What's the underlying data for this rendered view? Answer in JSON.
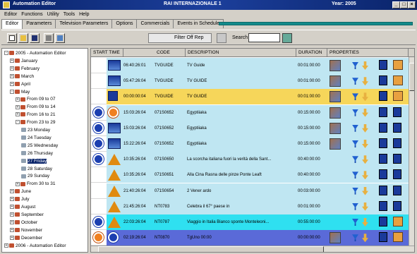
{
  "window": {
    "title": "Automation Editor",
    "channel": "RAI INTERNAZIONALE 1",
    "year": "Year: 2005",
    "controls": [
      "_",
      "□",
      "×"
    ]
  },
  "menu": [
    "Editor",
    "Functions",
    "Utility",
    "Tools",
    "Help"
  ],
  "tabs": [
    "Editor",
    "Parameters",
    "Television Parameters",
    "Options",
    "Commercials",
    "Events in Schedule"
  ],
  "toolbar": {
    "buttons": [
      "new-icon",
      "open-icon",
      "save-icon",
      "print-icon",
      "layout-icon"
    ],
    "filter_label": "Filter Off Rep",
    "search_label": "Search",
    "search_value": ""
  },
  "tree": [
    {
      "label": "2005 - Automation Editor",
      "level": 0,
      "toggle": "-"
    },
    {
      "label": "January",
      "level": 1,
      "toggle": "+"
    },
    {
      "label": "February",
      "level": 1,
      "toggle": "+"
    },
    {
      "label": "March",
      "level": 1,
      "toggle": "+"
    },
    {
      "label": "April",
      "level": 1,
      "toggle": "+"
    },
    {
      "label": "May",
      "level": 1,
      "toggle": "-"
    },
    {
      "label": "From 09 to 07",
      "level": 2,
      "toggle": "+"
    },
    {
      "label": "From 09 to 14",
      "level": 2,
      "toggle": "+"
    },
    {
      "label": "From 16 to 21",
      "level": 2,
      "toggle": "+"
    },
    {
      "label": "From 23 to 29",
      "level": 2,
      "toggle": "-"
    },
    {
      "label": "23 Monday",
      "level": 3,
      "toggle": ""
    },
    {
      "label": "24 Tuesday",
      "level": 3,
      "toggle": ""
    },
    {
      "label": "25 Wednesday",
      "level": 3,
      "toggle": ""
    },
    {
      "label": "26 Thursday",
      "level": 3,
      "toggle": ""
    },
    {
      "label": "27 Friday",
      "level": 3,
      "toggle": "",
      "selected": true
    },
    {
      "label": "28 Saturday",
      "level": 3,
      "toggle": ""
    },
    {
      "label": "29 Sunday",
      "level": 3,
      "toggle": ""
    },
    {
      "label": "From 30 to 31",
      "level": 2,
      "toggle": "+"
    },
    {
      "label": "June",
      "level": 1,
      "toggle": "+"
    },
    {
      "label": "July",
      "level": 1,
      "toggle": "+"
    },
    {
      "label": "August",
      "level": 1,
      "toggle": "+"
    },
    {
      "label": "September",
      "level": 1,
      "toggle": "+"
    },
    {
      "label": "October",
      "level": 1,
      "toggle": "+"
    },
    {
      "label": "November",
      "level": 1,
      "toggle": "+"
    },
    {
      "label": "December",
      "level": 1,
      "toggle": "+"
    },
    {
      "label": "2006 - Automation Editor",
      "level": 0,
      "toggle": "+"
    }
  ],
  "grid": {
    "columns": [
      "START TIME",
      "CODE",
      "DESCRIPTION",
      "DURATION",
      "PROPERTIES"
    ],
    "rows": [
      {
        "icons": [
          "",
          "blk-img"
        ],
        "time": "06:40:26:01",
        "code": "TVGUIDE",
        "desc": "TV Guide",
        "dur": "00:01:00:00",
        "bg": "#bfe6f2",
        "props": [
          "people",
          "funnel",
          "key",
          "b1",
          "b2"
        ]
      },
      {
        "icons": [
          "",
          "blk-img"
        ],
        "time": "05:47:26:04",
        "code": "TVGUIDE",
        "desc": "TV GUIDE",
        "dur": "00:01:00:00",
        "bg": "#bfe6f2",
        "props": [
          "people",
          "funnel",
          "key",
          "b1",
          "b2"
        ]
      },
      {
        "icons": [
          "",
          "blk"
        ],
        "time": "00:00:00:04",
        "code": "TVGUIDE",
        "desc": "TV GUIDE",
        "dur": "00:01:00:00",
        "bg": "#f6d65a",
        "props": [
          "people",
          "funnel",
          "key",
          "b1",
          "b2"
        ]
      },
      {
        "icons": [
          "circ",
          "circ-x"
        ],
        "time": "15:03:26:04",
        "code": "071S0652",
        "desc": "Egyptiiaka",
        "dur": "00:15:00:00",
        "bg": "#bfe6f2",
        "props": [
          "people",
          "funnel",
          "key",
          "b1",
          "b1"
        ]
      },
      {
        "icons": [
          "circ",
          "blk-img"
        ],
        "time": "15:03:26:04",
        "code": "071S0652",
        "desc": "Egyptiiaka",
        "dur": "00:15:00:00",
        "bg": "#bfe6f2",
        "props": [
          "people",
          "funnel",
          "key",
          "b1",
          "b1"
        ]
      },
      {
        "icons": [
          "circ",
          "blk-img"
        ],
        "time": "15:22:26:04",
        "code": "071S0652",
        "desc": "Egyptiiaka",
        "dur": "00:15:00:00",
        "bg": "#bfe6f2",
        "props": [
          "people",
          "funnel",
          "key",
          "b1",
          "b1"
        ]
      },
      {
        "icons": [
          "circ",
          "warn"
        ],
        "time": "10:35:26:04",
        "code": "071S0650",
        "desc": "La scorcha italiana fuori la verità della Sant...",
        "dur": "00:40:00:00",
        "bg": "#bfe6f2",
        "props": [
          "",
          "funnel",
          "key",
          "b1",
          "b1"
        ]
      },
      {
        "icons": [
          "",
          "warn"
        ],
        "time": "10:35:26:04",
        "code": "071S0651",
        "desc": "Alla Cina Rasna delle pinze Ponte Leaft",
        "dur": "00:40:00:00",
        "bg": "#bfe6f2",
        "props": [
          "",
          "funnel",
          "key",
          "b1",
          "b1"
        ]
      },
      {
        "icons": [
          "",
          "warn"
        ],
        "time": "21:40:26:04",
        "code": "071S0654",
        "desc": "2 Vener ardo",
        "dur": "00:03:00:00",
        "bg": "#bfe6f2",
        "props": [
          "",
          "funnel",
          "key",
          "b1",
          "b1"
        ]
      },
      {
        "icons": [
          "",
          "warn"
        ],
        "time": "21:45:26:04",
        "code": "NT0783",
        "desc": "Celebra il 67° paese in",
        "dur": "00:01:00:00",
        "bg": "#bfe6f2",
        "props": [
          "",
          "funnel",
          "key",
          "b1",
          "b1"
        ]
      },
      {
        "icons": [
          "circ",
          "warn"
        ],
        "time": "22:03:26:04",
        "code": "NT0787",
        "desc": "Viaggio in Italia Bianco sponte Monteleoni...",
        "dur": "00:55:00:00",
        "bg": "#2fe0f0",
        "props": [
          "",
          "funnel",
          "key",
          "b1",
          "b2"
        ]
      },
      {
        "icons": [
          "circ-x",
          "circ"
        ],
        "time": "02:19:26:04",
        "code": "NT0870",
        "desc": "TgUno 00:00",
        "dur": "00:00:00:00",
        "bg": "#5a6ad8",
        "props": [
          "people",
          "funnel",
          "key",
          "b1",
          "b2"
        ]
      }
    ]
  }
}
